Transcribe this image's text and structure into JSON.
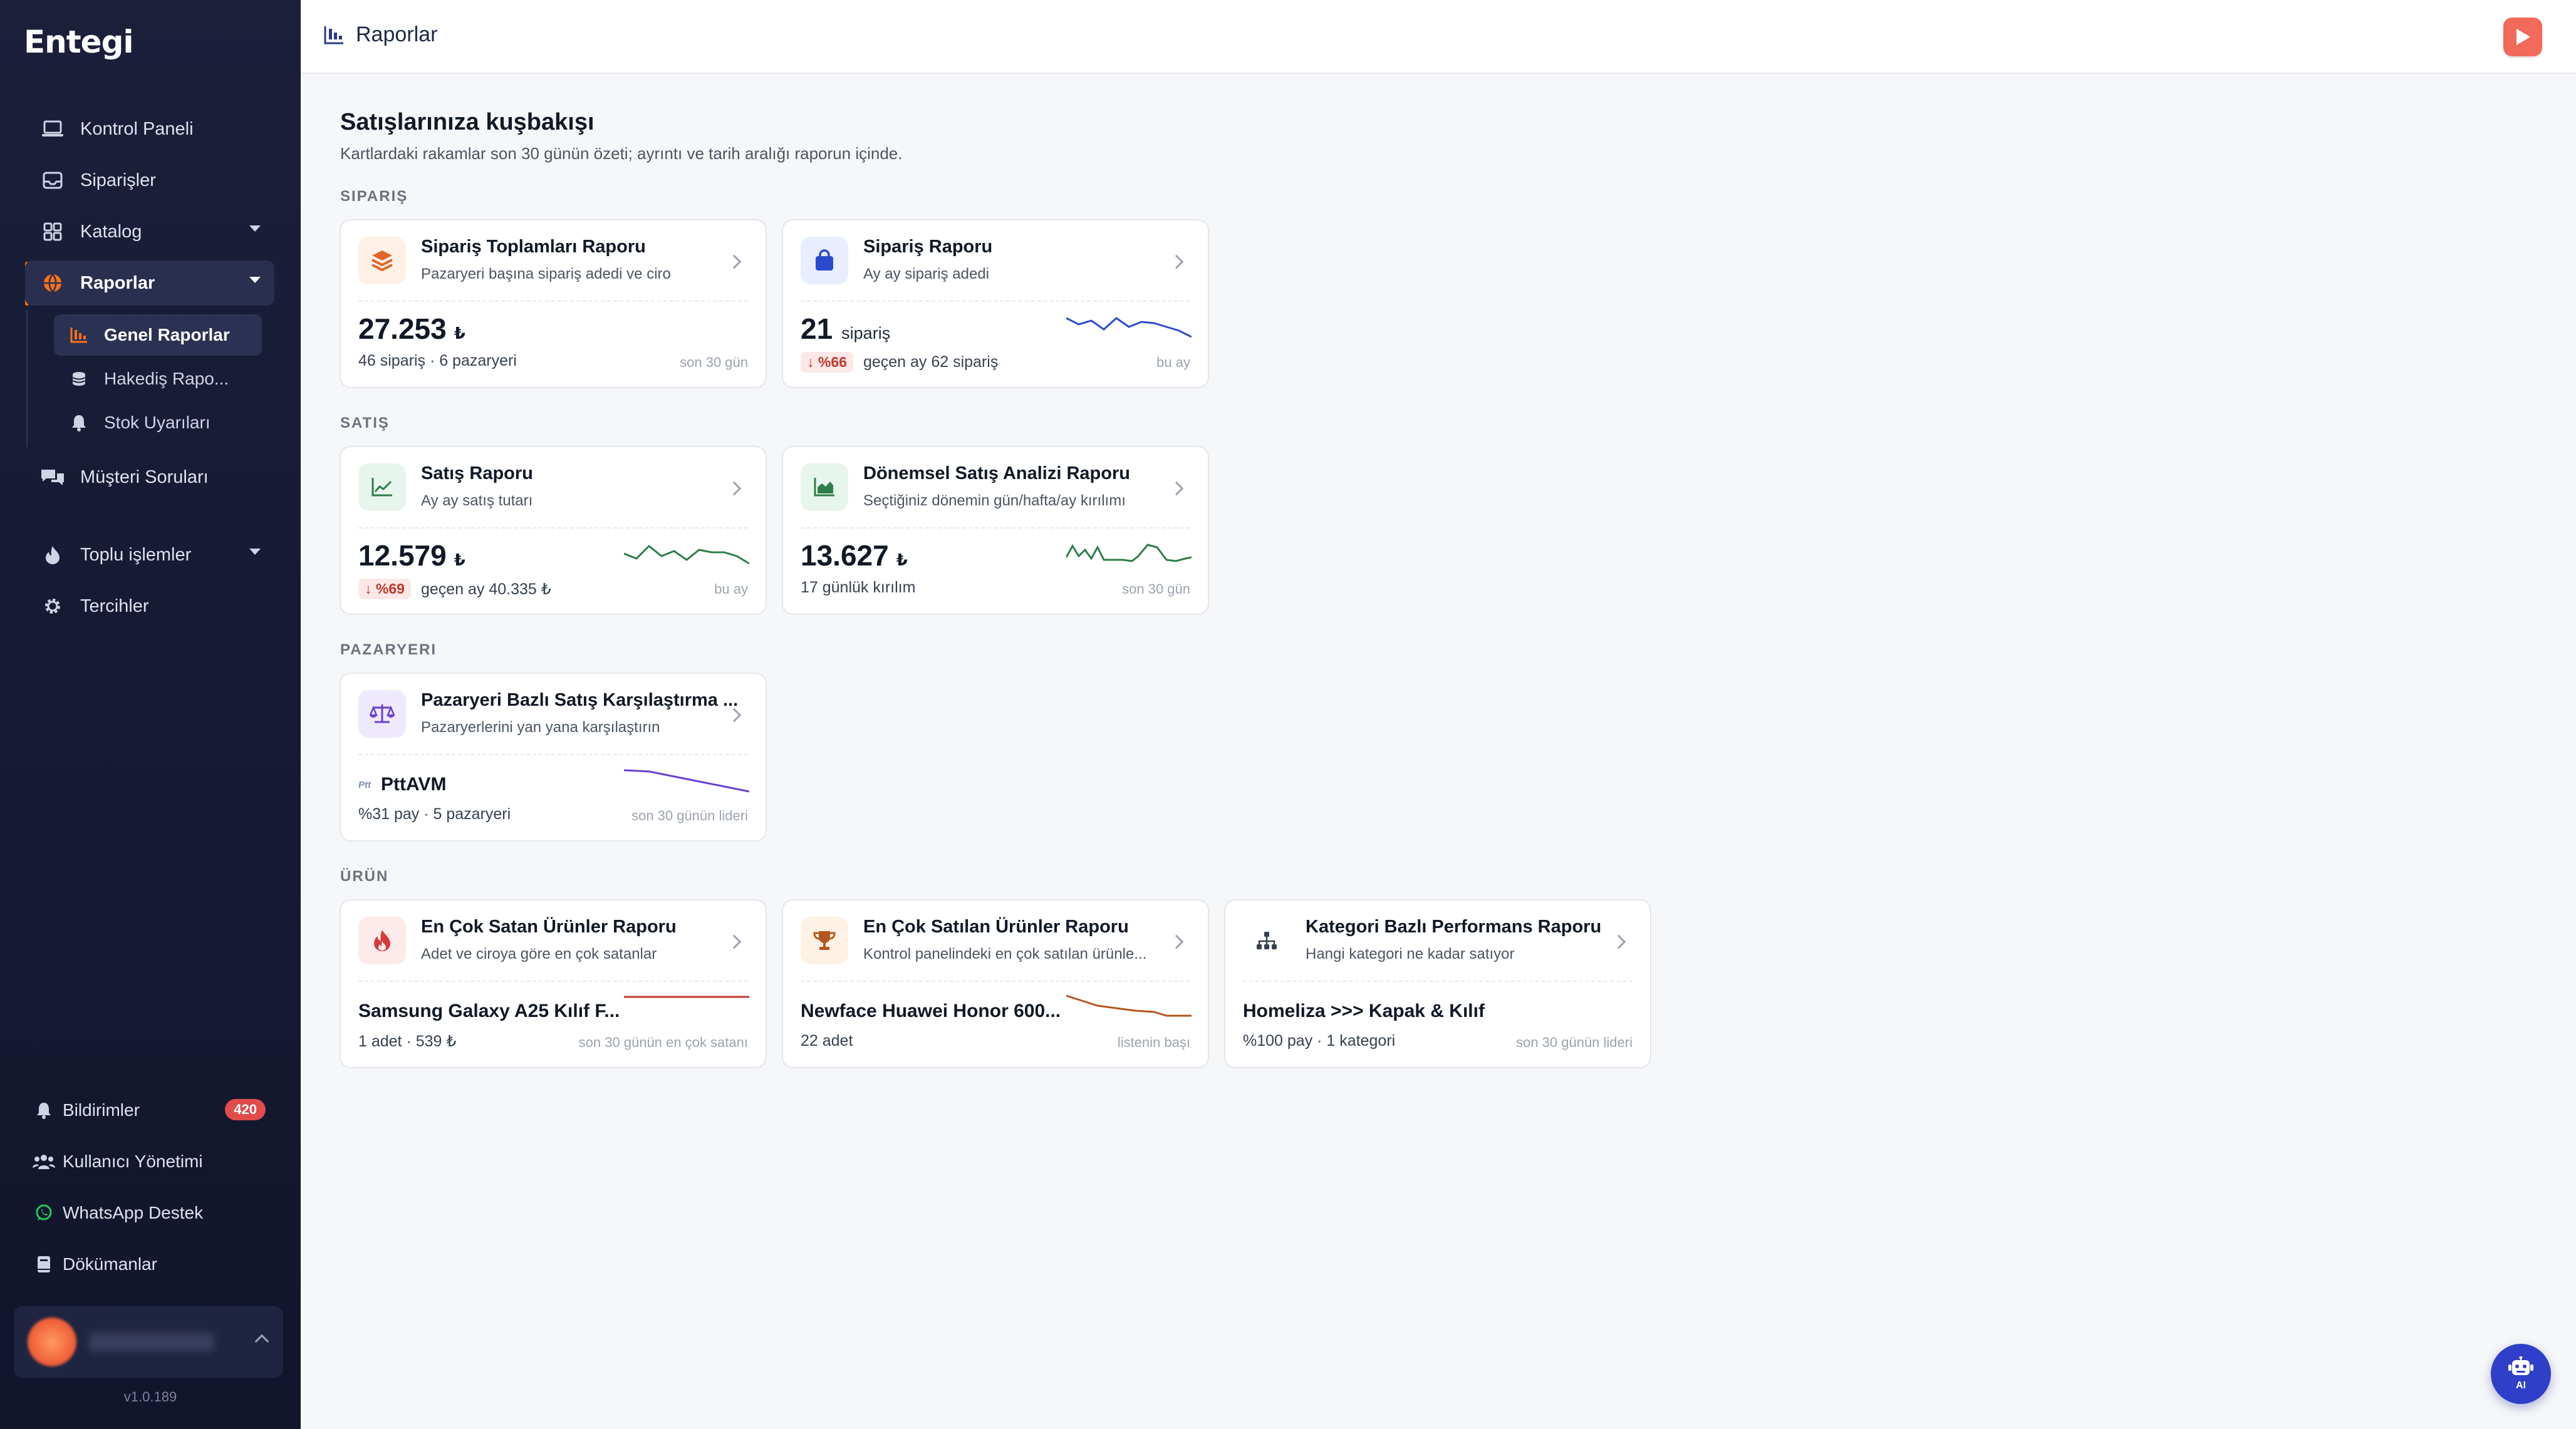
{
  "app": {
    "logo": "Entegi",
    "version": "v1.0.189"
  },
  "sidebar": {
    "items": [
      {
        "label": "Kontrol Paneli"
      },
      {
        "label": "Siparişler"
      },
      {
        "label": "Katalog"
      },
      {
        "label": "Raporlar"
      },
      {
        "label": "Müşteri Soruları"
      },
      {
        "label": "Toplu işlemler"
      },
      {
        "label": "Tercihler"
      }
    ],
    "subitems": [
      {
        "label": "Genel Raporlar"
      },
      {
        "label": "Hakediş Rapo..."
      },
      {
        "label": "Stok Uyarıları"
      }
    ],
    "bottom": [
      {
        "label": "Bildirimler",
        "badge": "420"
      },
      {
        "label": "Kullanıcı Yönetimi"
      },
      {
        "label": "WhatsApp Destek"
      },
      {
        "label": "Dökümanlar"
      }
    ]
  },
  "topbar": {
    "title": "Raporlar"
  },
  "page": {
    "title": "Satışlarınıza kuşbakışı",
    "subtitle": "Kartlardaki rakamlar son 30 günün özeti; ayrıntı ve tarih aralığı raporun içinde."
  },
  "sections": {
    "siparis": "SIPARIŞ",
    "satis": "SATIŞ",
    "pazaryeri": "PAZARYERI",
    "urun": "ÜRÜN"
  },
  "cards": {
    "siparis_toplamlari": {
      "title": "Sipariş Toplamları Raporu",
      "desc": "Pazaryeri başına sipariş adedi ve ciro",
      "value": "27.253",
      "unit": "₺",
      "meta": "46 sipariş · 6 pazaryeri",
      "note": "son 30 gün"
    },
    "siparis_raporu": {
      "title": "Sipariş Raporu",
      "desc": "Ay ay sipariş adedi",
      "value": "21",
      "unit": "sipariş",
      "delta": "↓ %66",
      "meta": "geçen ay 62 sipariş",
      "note": "bu ay"
    },
    "satis_raporu": {
      "title": "Satış Raporu",
      "desc": "Ay ay satış tutarı",
      "value": "12.579",
      "unit": "₺",
      "delta": "↓ %69",
      "meta": "geçen ay 40.335 ₺",
      "note": "bu ay"
    },
    "donemsel": {
      "title": "Dönemsel Satış Analizi Raporu",
      "desc": "Seçtiğiniz dönemin gün/hafta/ay kırılımı",
      "value": "13.627",
      "unit": "₺",
      "meta": "17 günlük kırılım",
      "note": "son 30 gün"
    },
    "pazaryeri_bazli": {
      "title": "Pazaryeri Bazlı Satış Karşılaştırma ...",
      "desc": "Pazaryerlerini yan yana karşılaştırın",
      "logo_text": "Ptt",
      "name": "PttAVM",
      "meta": "%31 pay · 5 pazaryeri",
      "note": "son 30 günün lideri"
    },
    "en_cok_satan": {
      "title": "En Çok Satan Ürünler Raporu",
      "desc": "Adet ve ciroya göre en çok satanlar",
      "name": "Samsung Galaxy A25 Kılıf F...",
      "meta": "1 adet · 539 ₺",
      "note": "son 30 günün en çok satanı"
    },
    "en_cok_satilan": {
      "title": "En Çok Satılan Ürünler Raporu",
      "desc": "Kontrol panelindeki en çok satılan ürünle...",
      "name": "Newface Huawei Honor 600...",
      "meta": "22 adet",
      "note": "listenin başı"
    },
    "kategori": {
      "title": "Kategori Bazlı Performans Raporu",
      "desc": "Hangi kategori ne kadar satıyor",
      "name": "Homeliza >>> Kapak & Kılıf",
      "meta": "%100 pay · 1 kategori",
      "note": "son 30 günün lideri"
    }
  },
  "ai_button": {
    "label": "AI"
  },
  "colors": {
    "sidebar_bg": "#1b1f3a",
    "accent_orange": "#f97316",
    "decline_red": "#c0392b",
    "spark_blue": "#2b4bcf",
    "spark_green": "#2f7d4a",
    "spark_purple": "#6b3fd4",
    "spark_red": "#c0392b",
    "spark_orange": "#b5561f"
  }
}
